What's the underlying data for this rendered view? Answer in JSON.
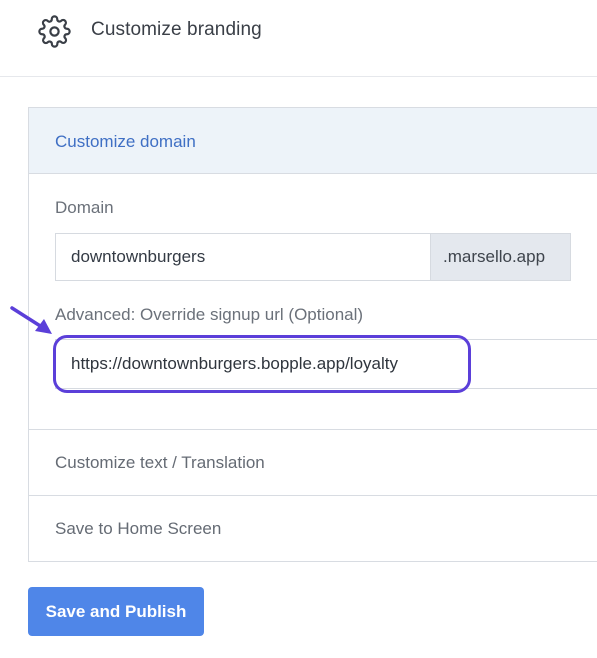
{
  "header": {
    "title": "Customize branding",
    "icon": "gear-icon"
  },
  "panel": {
    "title": "Customize domain",
    "domain": {
      "label": "Domain",
      "value": "downtownburgers",
      "suffix": ".marsello.app"
    },
    "override": {
      "label": "Advanced: Override signup url (Optional)",
      "value": "https://downtownburgers.bopple.app/loyalty"
    },
    "sections": [
      {
        "label": "Customize text / Translation"
      },
      {
        "label": "Save to Home Screen"
      }
    ]
  },
  "actions": {
    "save_label": "Save and Publish"
  },
  "colors": {
    "accent": "#4f86e8",
    "highlight": "#5b3fd9",
    "panel_header": "#edf3f9"
  }
}
